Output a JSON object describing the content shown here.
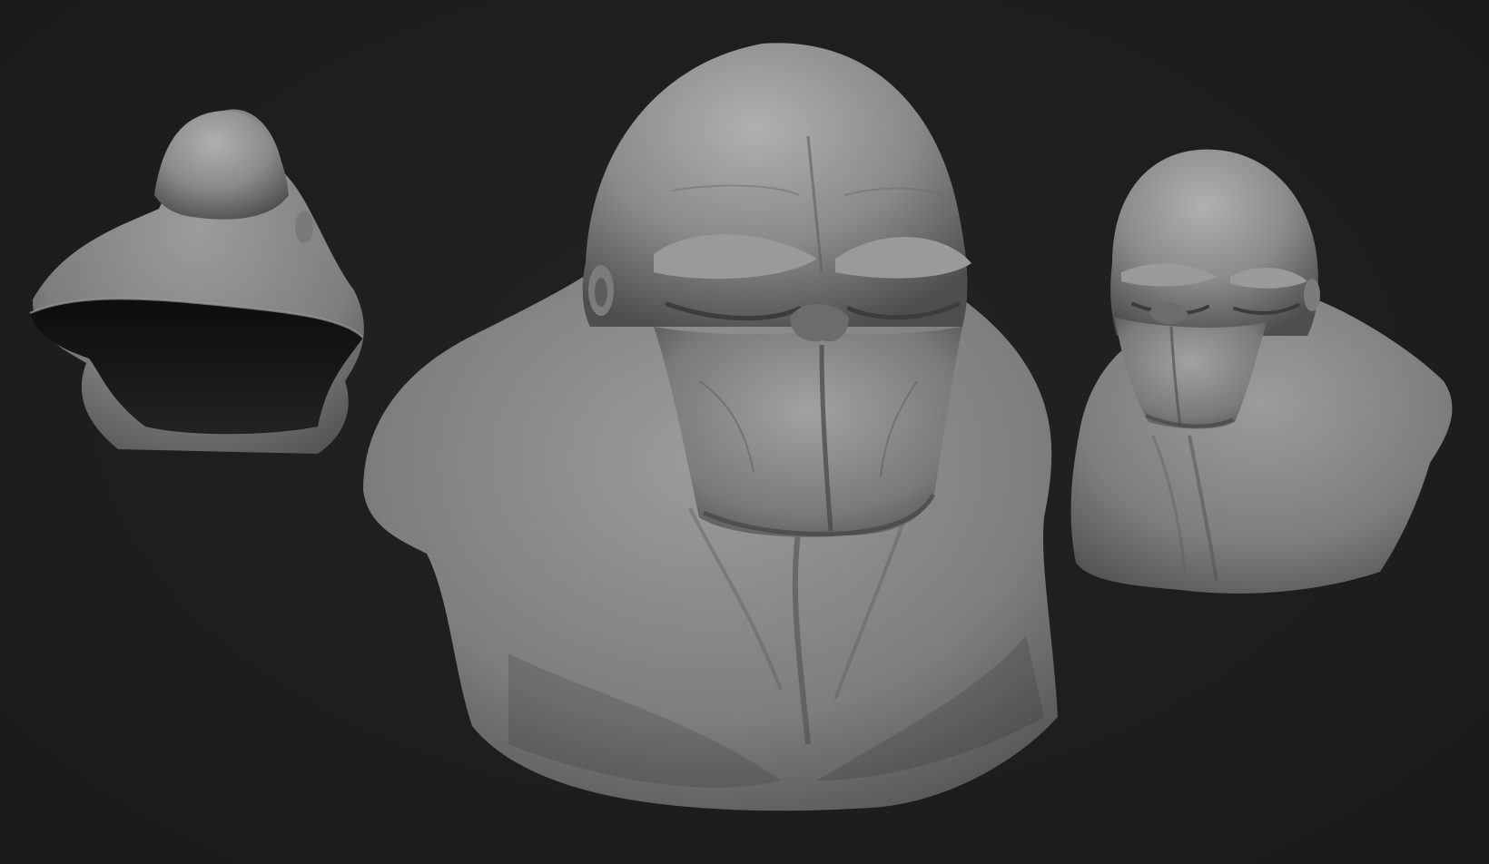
{
  "viewport": {
    "background_color": "#1d1d1d",
    "material_base_color": "#8a8a8a",
    "material_highlight_color": "#c4c4c4",
    "material_shadow_color": "#3a3a3a"
  },
  "models": [
    {
      "view": "back",
      "icon": "sculpt-bust-back-icon"
    },
    {
      "view": "front",
      "icon": "sculpt-bust-front-icon"
    },
    {
      "view": "three-quarter",
      "icon": "sculpt-bust-three-quarter-icon"
    }
  ]
}
